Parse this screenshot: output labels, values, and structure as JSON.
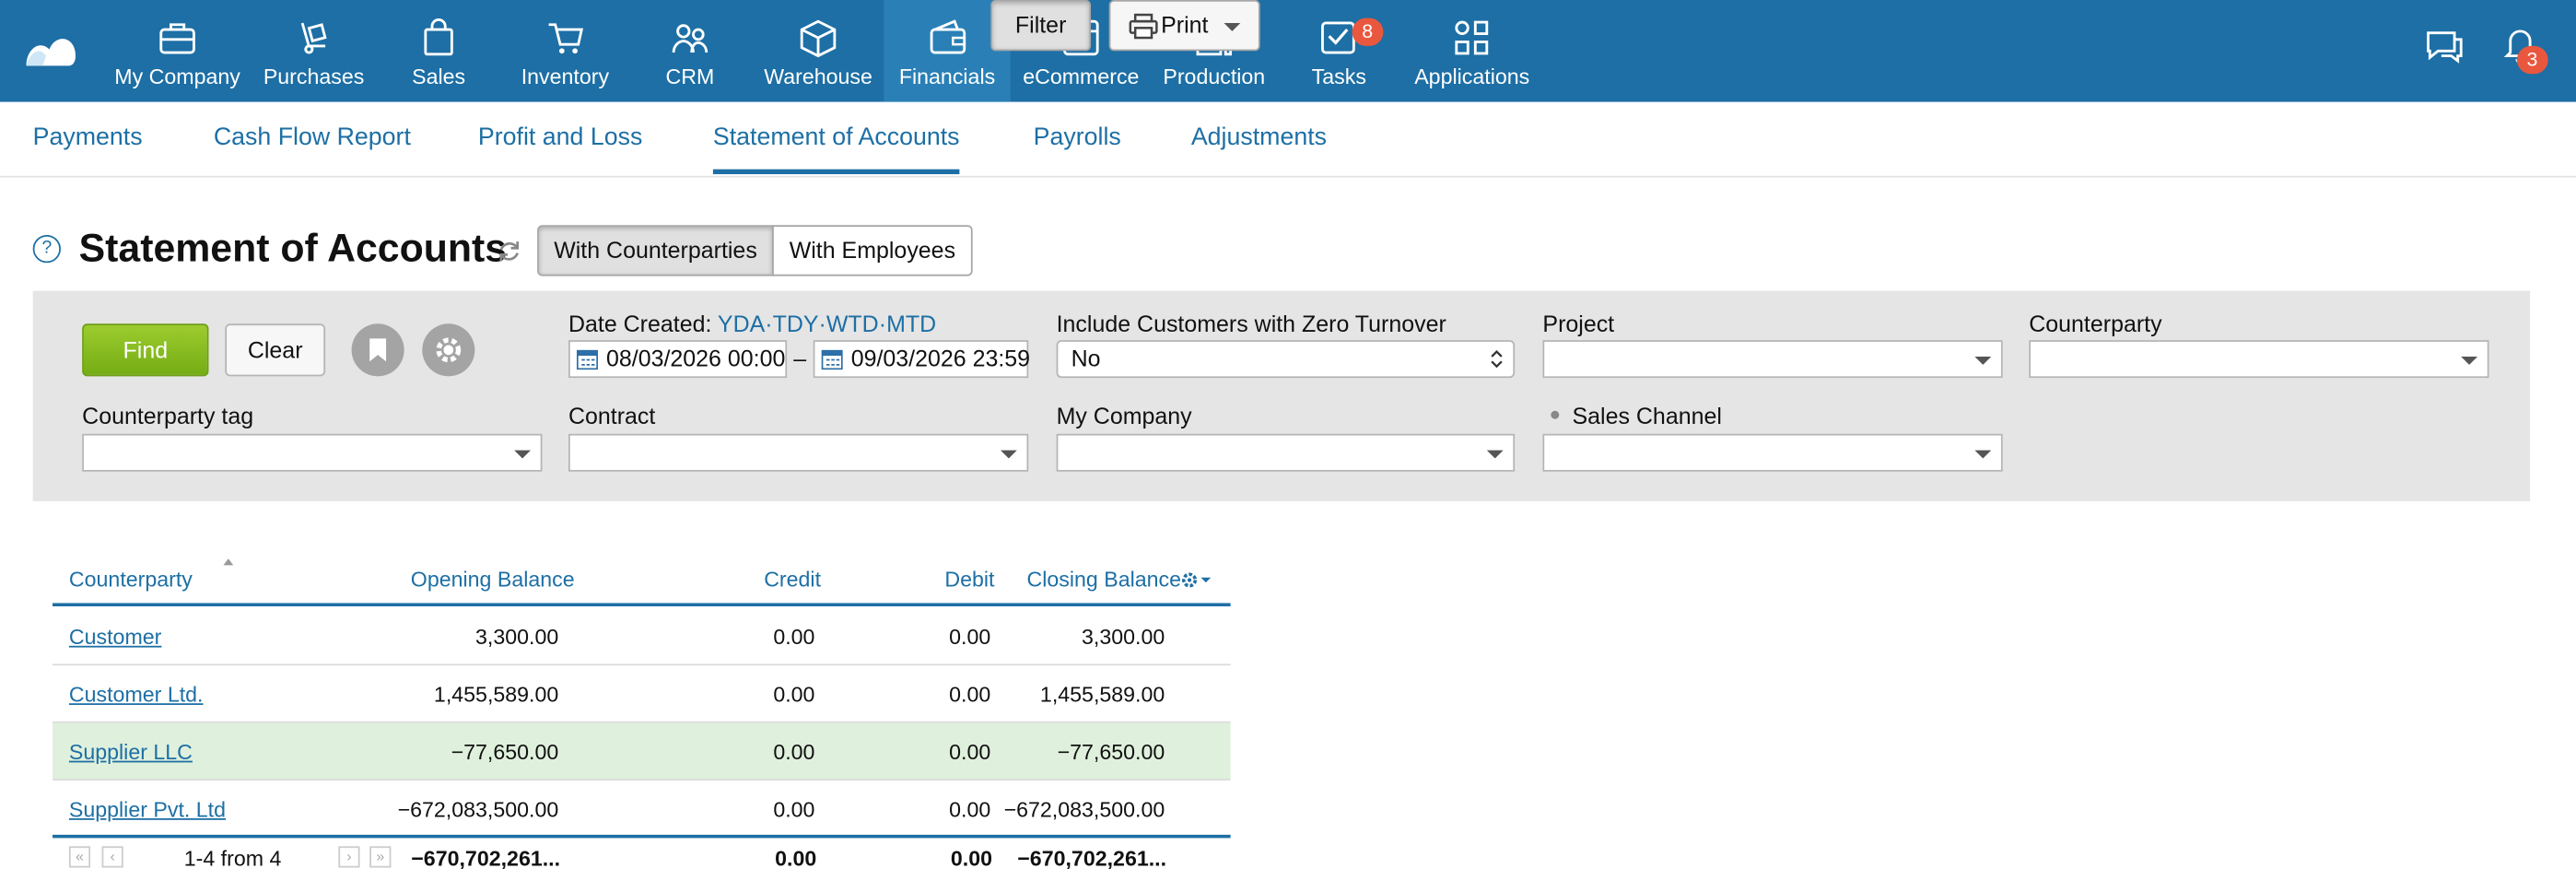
{
  "colors": {
    "brand": "#1d6fa5",
    "find": "#8bbf22",
    "badge": "#e9573f",
    "highlight_row": "#dff0dc"
  },
  "nav": {
    "items": [
      {
        "label": "My Company",
        "icon": "briefcase-icon"
      },
      {
        "label": "Purchases",
        "icon": "hand-truck-icon"
      },
      {
        "label": "Sales",
        "icon": "shopping-bag-icon"
      },
      {
        "label": "Inventory",
        "icon": "cart-icon"
      },
      {
        "label": "CRM",
        "icon": "people-icon"
      },
      {
        "label": "Warehouse",
        "icon": "box-icon"
      },
      {
        "label": "Financials",
        "icon": "wallet-icon"
      },
      {
        "label": "eCommerce",
        "icon": "storefront-icon"
      },
      {
        "label": "Production",
        "icon": "factory-icon"
      },
      {
        "label": "Tasks",
        "icon": "checklist-icon"
      },
      {
        "label": "Applications",
        "icon": "apps-icon"
      }
    ],
    "tasks_badge": "8",
    "notifications_badge": "3"
  },
  "subnav": [
    "Payments",
    "Cash Flow Report",
    "Profit and Loss",
    "Statement of Accounts",
    "Payrolls",
    "Adjustments"
  ],
  "page": {
    "help": "?",
    "title": "Statement of Accounts",
    "with_counterparties": "With Counterparties",
    "with_employees": "With Employees",
    "filter": "Filter",
    "print": "Print"
  },
  "filters": {
    "find": "Find",
    "clear": "Clear",
    "date_created_label": "Date Created:",
    "quick_ranges": [
      "YDA",
      "TDY",
      "WTD",
      "MTD"
    ],
    "date_from": "08/03/2026 00:00",
    "date_sep": "–",
    "date_to": "09/03/2026 23:59",
    "zero_turnover_label": "Include Customers with Zero Turnover",
    "zero_turnover_value": "No",
    "project_label": "Project",
    "counterparty_label": "Counterparty",
    "counterparty_tag_label": "Counterparty tag",
    "contract_label": "Contract",
    "my_company_label": "My Company",
    "sales_channel_label": "Sales Channel"
  },
  "table": {
    "headers": {
      "counterparty": "Counterparty",
      "opening": "Opening Balance",
      "credit": "Credit",
      "debit": "Debit",
      "closing": "Closing Balance"
    },
    "rows": [
      {
        "counterparty": "Customer",
        "opening": "3,300.00",
        "credit": "0.00",
        "debit": "0.00",
        "closing": "3,300.00"
      },
      {
        "counterparty": "Customer Ltd.",
        "opening": "1,455,589.00",
        "credit": "0.00",
        "debit": "0.00",
        "closing": "1,455,589.00"
      },
      {
        "counterparty": "Supplier LLC",
        "opening": "−77,650.00",
        "credit": "0.00",
        "debit": "0.00",
        "closing": "−77,650.00"
      },
      {
        "counterparty": "Supplier Pvt. Ltd",
        "opening": "−672,083,500.00",
        "credit": "0.00",
        "debit": "0.00",
        "closing": "−672,083,500.00"
      }
    ],
    "pagination": "1-4 from 4",
    "totals": {
      "opening": "−670,702,261...",
      "credit": "0.00",
      "debit": "0.00",
      "closing": "−670,702,261..."
    }
  }
}
